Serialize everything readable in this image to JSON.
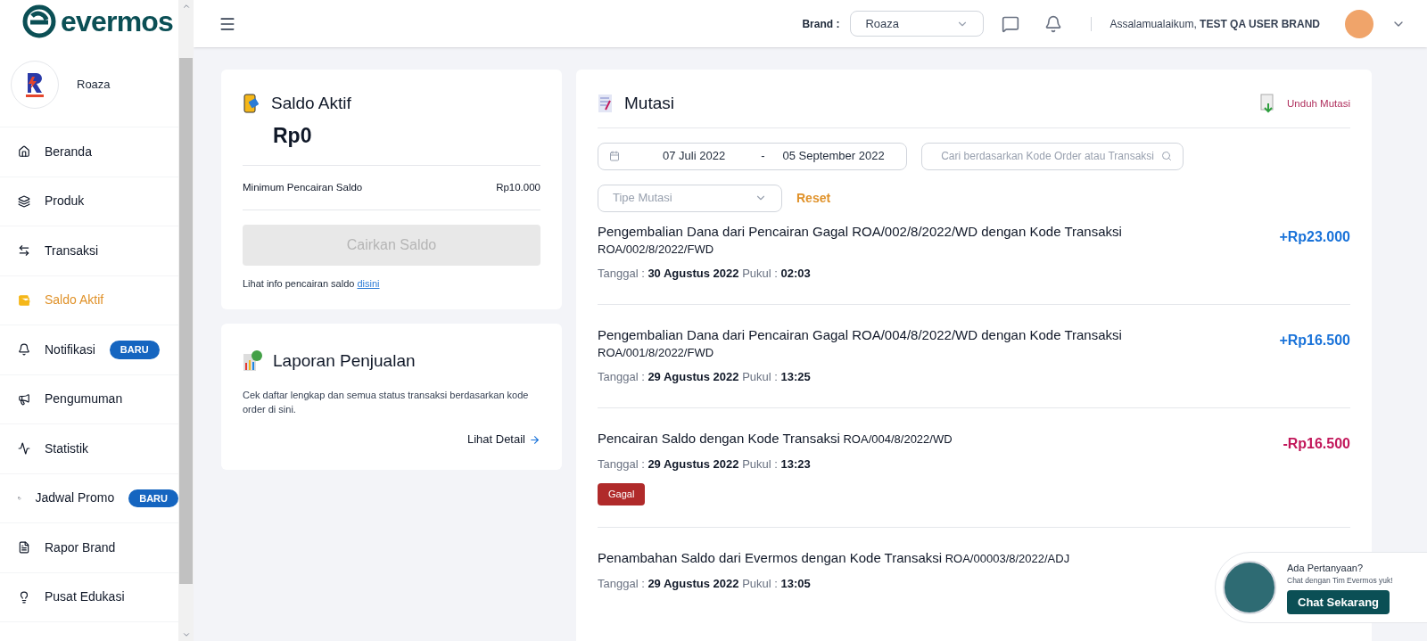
{
  "brand_logo": "evermos",
  "store": {
    "name": "Roaza"
  },
  "sidebar": {
    "items": [
      {
        "label": "Beranda",
        "selected": false
      },
      {
        "label": "Produk",
        "selected": false
      },
      {
        "label": "Transaksi",
        "selected": false
      },
      {
        "label": "Saldo Aktif",
        "selected": true
      },
      {
        "label": "Notifikasi",
        "selected": false,
        "badge": "BARU"
      },
      {
        "label": "Pengumuman",
        "selected": false
      },
      {
        "label": "Statistik",
        "selected": false
      },
      {
        "label": "Jadwal Promo",
        "selected": false,
        "badge": "BARU"
      },
      {
        "label": "Rapor Brand",
        "selected": false
      },
      {
        "label": "Pusat Edukasi",
        "selected": false
      }
    ]
  },
  "header": {
    "brand_label": "Brand :",
    "brand_value": "Roaza",
    "greeting": "Assalamualaikum, **TEST QA USER BRAND**"
  },
  "saldo": {
    "title": "Saldo Aktif",
    "amount": "Rp0",
    "min_label": "Minimum Pencairan Saldo",
    "min_value": "Rp10.000",
    "button": "Cairkan Saldo",
    "button_disabled": true,
    "info": "Lihat info pencairan saldo",
    "info_link": "disini"
  },
  "laporan": {
    "title": "Laporan Penjualan",
    "description": "Cek daftar lengkap dan semua status transaksi berdasarkan kode order di sini.",
    "link": "Lihat Detail"
  },
  "mutasi": {
    "title": "Mutasi",
    "download": "Unduh Mutasi",
    "date_from": "07 Juli 2022",
    "date_separator": "-",
    "date_to": "05 September 2022",
    "search_placeholder": "Cari berdasarkan Kode Order atau Transaksi",
    "type_placeholder": "Tipe Mutasi",
    "reset": "Reset",
    "entries": [
      {
        "kind": "credit",
        "description": "Pengembalian Dana dari Pencairan Gagal ROA/002/8/2022/WD dengan Kode Transaksi",
        "code": "ROA/002/8/2022/FWD",
        "inline_code": false,
        "date_label": "Tanggal :",
        "date": "30 Agustus 2022",
        "time_label": "Pukul :",
        "time": "02:03",
        "amount": "+Rp23.000"
      },
      {
        "kind": "credit",
        "description": "Pengembalian Dana dari Pencairan Gagal ROA/004/8/2022/WD dengan Kode Transaksi",
        "code": "ROA/001/8/2022/FWD",
        "inline_code": false,
        "date_label": "Tanggal :",
        "date": "29 Agustus 2022",
        "time_label": "Pukul :",
        "time": "13:25",
        "amount": "+Rp16.500"
      },
      {
        "kind": "debit",
        "description": "Pencairan Saldo dengan Kode Transaksi",
        "code": "ROA/004/8/2022/WD",
        "inline_code": true,
        "date_label": "Tanggal :",
        "date": "29 Agustus 2022",
        "time_label": "Pukul :",
        "time": "13:23",
        "amount": "-Rp16.500",
        "status": "Gagal"
      },
      {
        "description": "Penambahan Saldo dari Evermos dengan Kode Transaksi",
        "code": "ROA/00003/8/2022/ADJ",
        "inline_code": true,
        "date_label": "Tanggal :",
        "date": "29 Agustus 2022",
        "time_label": "Pukul :",
        "time": "13:05"
      }
    ]
  },
  "chat_widget": {
    "title": "Ada Pertanyaan?",
    "subtitle": "Chat dengan Tim Evermos yuk!",
    "button": "Chat Sekarang"
  }
}
